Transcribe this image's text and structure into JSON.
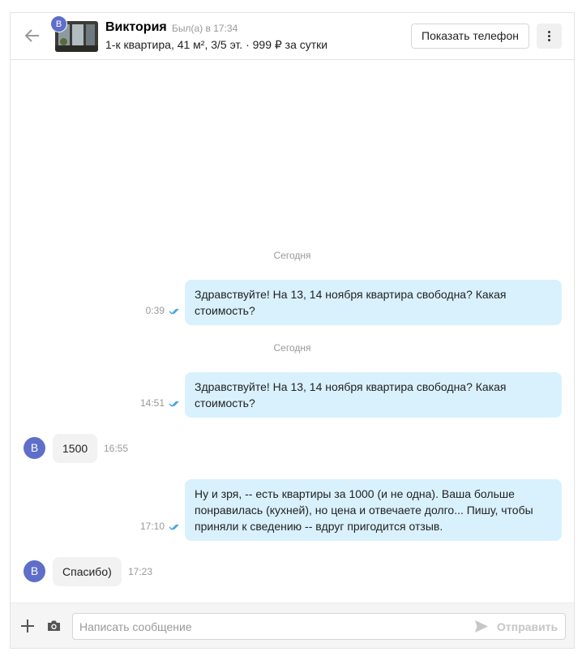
{
  "header": {
    "avatar_letter": "В",
    "contact_name": "Виктория",
    "last_seen": "Был(а) в 17:34",
    "listing": "1-к квартира, 41 м², 3/5 эт. · 999 ₽ за сутки",
    "show_phone_label": "Показать телефон"
  },
  "messages": {
    "date_1": "Сегодня",
    "out_1": {
      "text": "Здравствуйте! На 13, 14 ноября квартира свободна? Какая стоимость?",
      "time": "0:39"
    },
    "date_2": "Сегодня",
    "out_2": {
      "text": "Здравствуйте! На 13, 14 ноября квартира свободна? Какая стоимость?",
      "time": "14:51"
    },
    "in_1": {
      "avatar_letter": "В",
      "text": "1500",
      "time": "16:55"
    },
    "out_3": {
      "text": "Ну и зря, -- есть квартиры за 1000 (и не одна). Ваша больше понравилась (кухней), но цена и отвечаете долго... Пишу, чтобы приняли к сведению -- вдруг пригодится отзыв.",
      "time": "17:10"
    },
    "in_2": {
      "avatar_letter": "В",
      "text": "Спасибо)",
      "time": "17:23"
    }
  },
  "composer": {
    "placeholder": "Написать сообщение",
    "send_label": "Отправить"
  },
  "icons": {
    "back": "arrow-left-icon",
    "more": "more-vertical-icon",
    "read": "double-check-icon",
    "add": "plus-icon",
    "camera": "camera-icon",
    "send": "send-icon"
  },
  "colors": {
    "outgoing_bubble": "#d9f1fd",
    "incoming_bubble": "#f2f2f2",
    "avatar": "#5e6ec9",
    "read_check": "#3aa0dc"
  }
}
